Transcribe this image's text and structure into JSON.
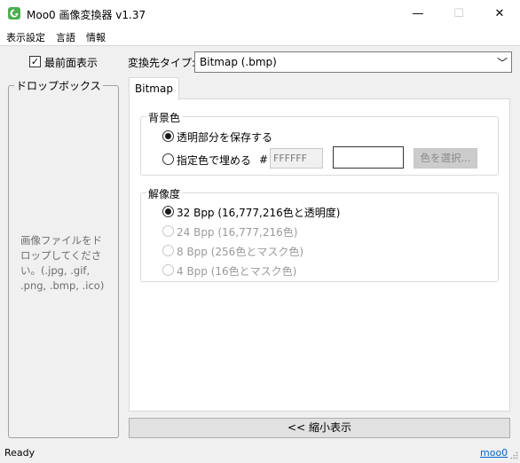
{
  "window": {
    "title": "Moo0 画像変換器 v1.37",
    "controls": {
      "minimize": "—",
      "maximize": "☐",
      "close": "✕"
    }
  },
  "menu": [
    "表示設定",
    "言語",
    "情報"
  ],
  "topmost": {
    "label": "最前面表示",
    "checked": true,
    "mark": "✓"
  },
  "dropbox": {
    "title": "ドロップボックス",
    "hint": "画像ファイルをドロップしてください。(.jpg, .gif, .png, .bmp, .ico)"
  },
  "target": {
    "label": "変換先タイプ:",
    "value": "Bitmap (.bmp)",
    "chevron": "﹀"
  },
  "tab": {
    "label": "Bitmap"
  },
  "background": {
    "title": "背景色",
    "options": [
      {
        "label": "透明部分を保存する",
        "selected": true,
        "disabled": false
      },
      {
        "label": "指定色で埋める",
        "selected": false,
        "disabled": false
      }
    ],
    "hash": "#",
    "hex_value": "FFFFFF",
    "swatch_color": "#ffffff",
    "select_button": "色を選択..."
  },
  "resolution": {
    "title": "解像度",
    "options": [
      {
        "label": "32 Bpp (16,777,216色と透明度)",
        "selected": true,
        "disabled": false
      },
      {
        "label": "24 Bpp (16,777,216色)",
        "selected": false,
        "disabled": true
      },
      {
        "label": "8 Bpp (256色とマスク色)",
        "selected": false,
        "disabled": true
      },
      {
        "label": "4 Bpp (16色とマスク色)",
        "selected": false,
        "disabled": true
      }
    ]
  },
  "shrink_button": "<< 縮小表示",
  "status": "Ready",
  "link": "moo0",
  "colors": {
    "link": "#0066cc",
    "icon_green": "#4caf50"
  }
}
